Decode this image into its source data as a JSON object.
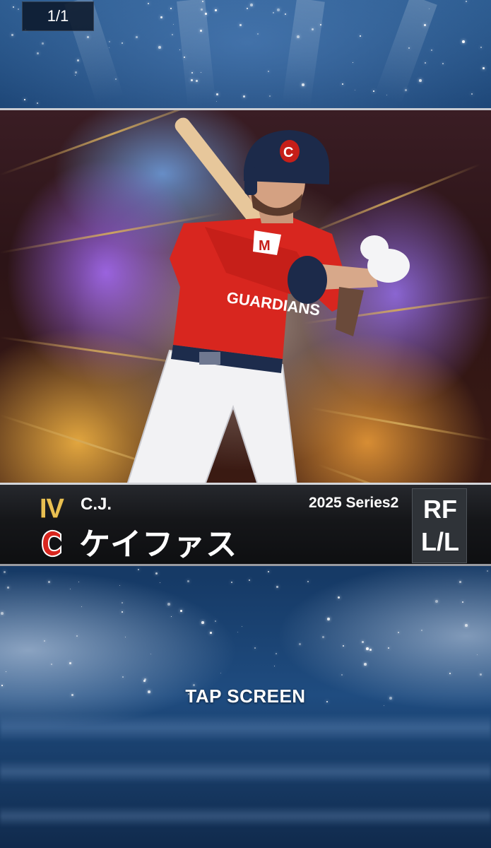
{
  "counter": "1/1",
  "card": {
    "rank": "IV",
    "team_logo": "cleveland-c-logo",
    "first_name": "C.J.",
    "last_name": "ケイファス",
    "series": "2025 Series2",
    "position": "RF",
    "bats_throws": "L/L",
    "jersey_text": "GUARDIANS"
  },
  "prompt": "TAP SCREEN",
  "colors": {
    "rank_gold": "#e9c052",
    "jersey_red": "#d8261f",
    "helmet_navy": "#1c2a4a",
    "info_bar": "#151619"
  }
}
